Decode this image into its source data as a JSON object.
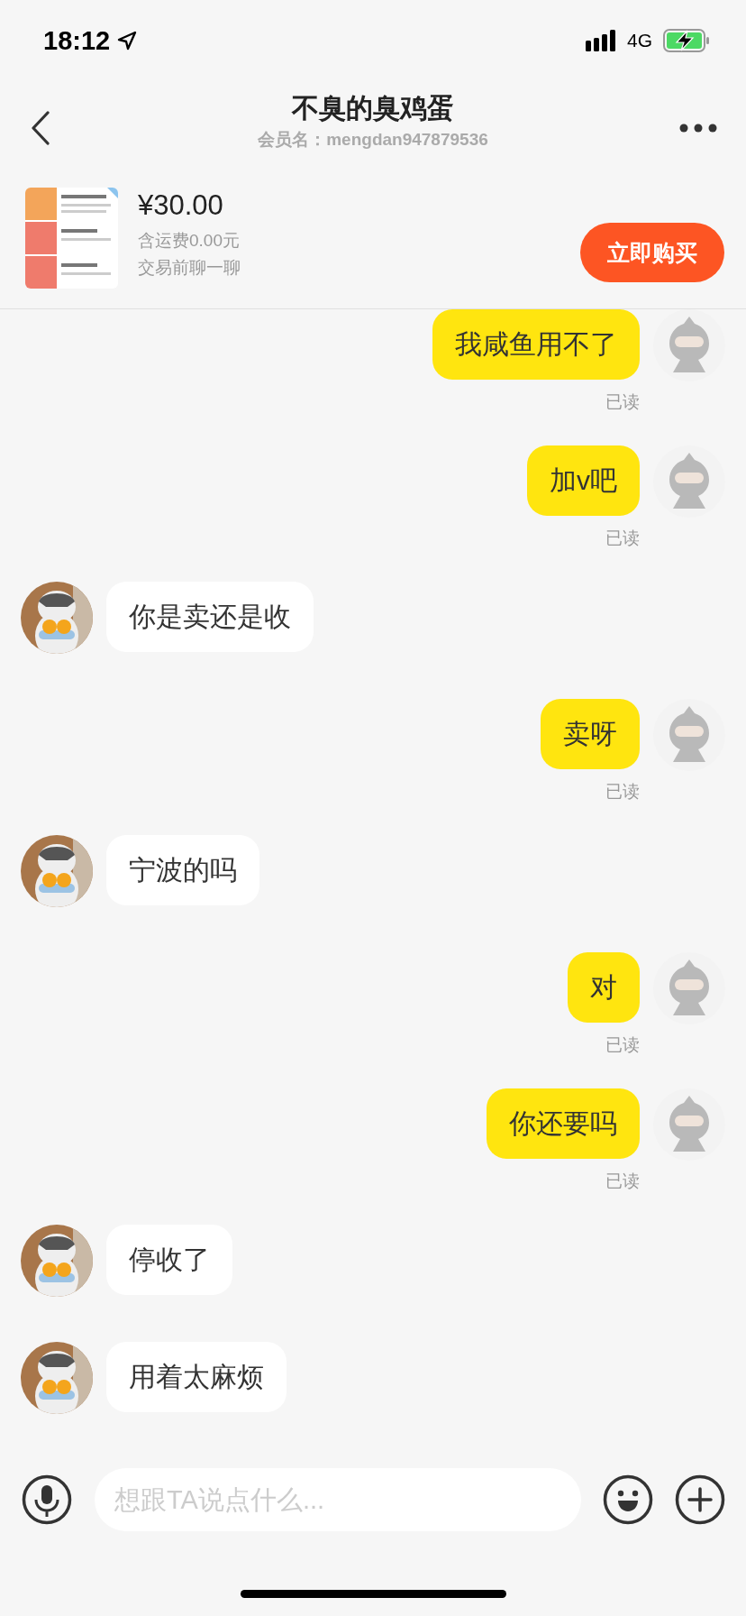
{
  "status_bar": {
    "time": "18:12",
    "network": "4G"
  },
  "header": {
    "title": "不臭的臭鸡蛋",
    "subtitle": "会员名：mengdan947879536"
  },
  "product": {
    "price": "¥30.00",
    "shipping": "含运费0.00元",
    "note": "交易前聊一聊",
    "buy_button": "立即购买"
  },
  "messages": [
    {
      "kind": "sent",
      "text": "我咸鱼用不了",
      "read_label": "已读"
    },
    {
      "kind": "sent",
      "text": "加v吧",
      "read_label": "已读"
    },
    {
      "kind": "received",
      "text": "你是卖还是收"
    },
    {
      "kind": "sent",
      "text": "卖呀",
      "read_label": "已读"
    },
    {
      "kind": "received",
      "text": "宁波的吗"
    },
    {
      "kind": "sent",
      "text": "对",
      "read_label": "已读"
    },
    {
      "kind": "sent",
      "text": "你还要吗",
      "read_label": "已读"
    },
    {
      "kind": "received",
      "text": "停收了"
    },
    {
      "kind": "received",
      "text": "用着太麻烦"
    }
  ],
  "input": {
    "placeholder": "想跟TA说点什么..."
  }
}
